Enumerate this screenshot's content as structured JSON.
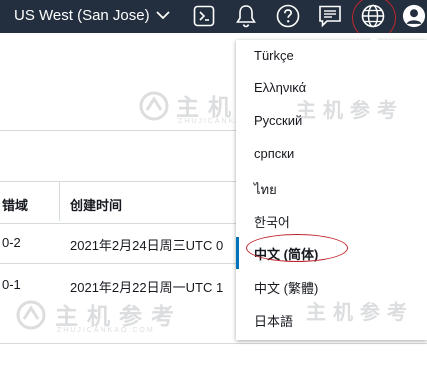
{
  "nav": {
    "region_label": "US West (San Jose)",
    "icons": [
      "terminal-icon",
      "bell-icon",
      "help-icon",
      "chat-icon",
      "globe-icon",
      "user-icon"
    ]
  },
  "table": {
    "headers": [
      "错域",
      "创建时间"
    ],
    "rows": [
      [
        "0-2",
        "2021年2月24日周三UTC 0"
      ],
      [
        "0-1",
        "2021年2月22日周一UTC 1"
      ]
    ]
  },
  "language_menu": {
    "items": [
      "Türkçe",
      "Ελληνικά",
      "Русский",
      "српски",
      "ไทย",
      "한국어",
      "中文 (简体)",
      "中文 (繁體)",
      "日本語"
    ],
    "selected_index": 6
  },
  "watermark": {
    "title": "主机参考",
    "subtitle": "ZHUJICANKAO.COM"
  },
  "colors": {
    "topbar": "#232f3e",
    "selected_accent": "#0073bb",
    "annotation": "#c0262d"
  }
}
